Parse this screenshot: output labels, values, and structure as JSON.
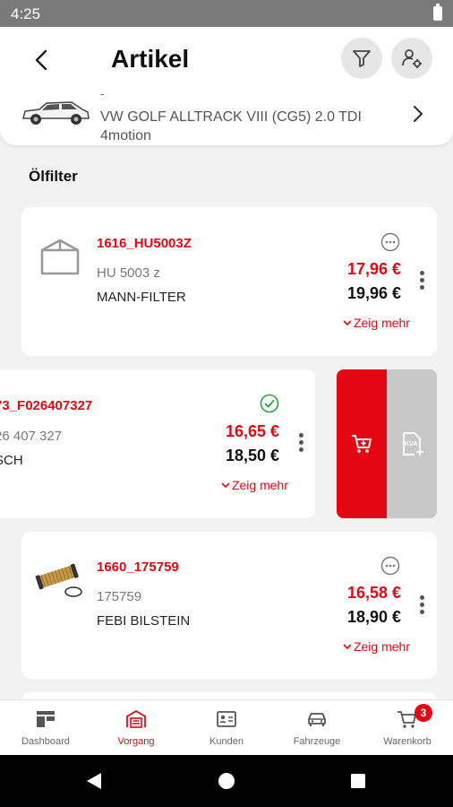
{
  "status_bar": {
    "time": "4:25"
  },
  "header": {
    "title": "Artikel"
  },
  "vehicle": {
    "dash": "-",
    "name": "VW GOLF ALLTRACK VIII (CG5) 2.0 TDI 4motion"
  },
  "section_title": "Ölfilter",
  "articles": [
    {
      "number": "1616_HU5003Z",
      "sub": "HU 5003 z",
      "brand": "MANN-FILTER",
      "price_net": "17,96 €",
      "price_gross": "19,96 €",
      "more": "Zeig mehr",
      "status_icon": "more-circle-icon",
      "image": "box-placeholder-icon"
    },
    {
      "number": "73_F026407327",
      "sub": "26 407 327",
      "brand": "SCH",
      "price_net": "16,65 €",
      "price_gross": "18,50 €",
      "more": "Zeig mehr",
      "status_icon": "check-circle-icon",
      "image": "none"
    },
    {
      "number": "1660_175759",
      "sub": "175759",
      "brand": "FEBI BILSTEIN",
      "price_net": "16,58 €",
      "price_gross": "18,90 €",
      "more": "Zeig mehr",
      "status_icon": "more-circle-icon",
      "image": "oil-filter-image"
    }
  ],
  "swipe_actions": {
    "cart_icon": "add-to-cart-icon",
    "kva_icon": "kva-document-icon",
    "kva_label": "KVA"
  },
  "bottom_nav": [
    {
      "label": "Dashboard",
      "icon": "dashboard-icon",
      "active": false
    },
    {
      "label": "Vorgang",
      "icon": "garage-icon",
      "active": true
    },
    {
      "label": "Kunden",
      "icon": "id-card-icon",
      "active": false
    },
    {
      "label": "Fahrzeuge",
      "icon": "car-icon",
      "active": false
    },
    {
      "label": "Warenkorb",
      "icon": "cart-icon",
      "active": false,
      "badge": "3"
    }
  ],
  "colors": {
    "accent": "#e30613",
    "background": "#f2f2f2",
    "swipe_secondary": "#c8c8c8"
  }
}
